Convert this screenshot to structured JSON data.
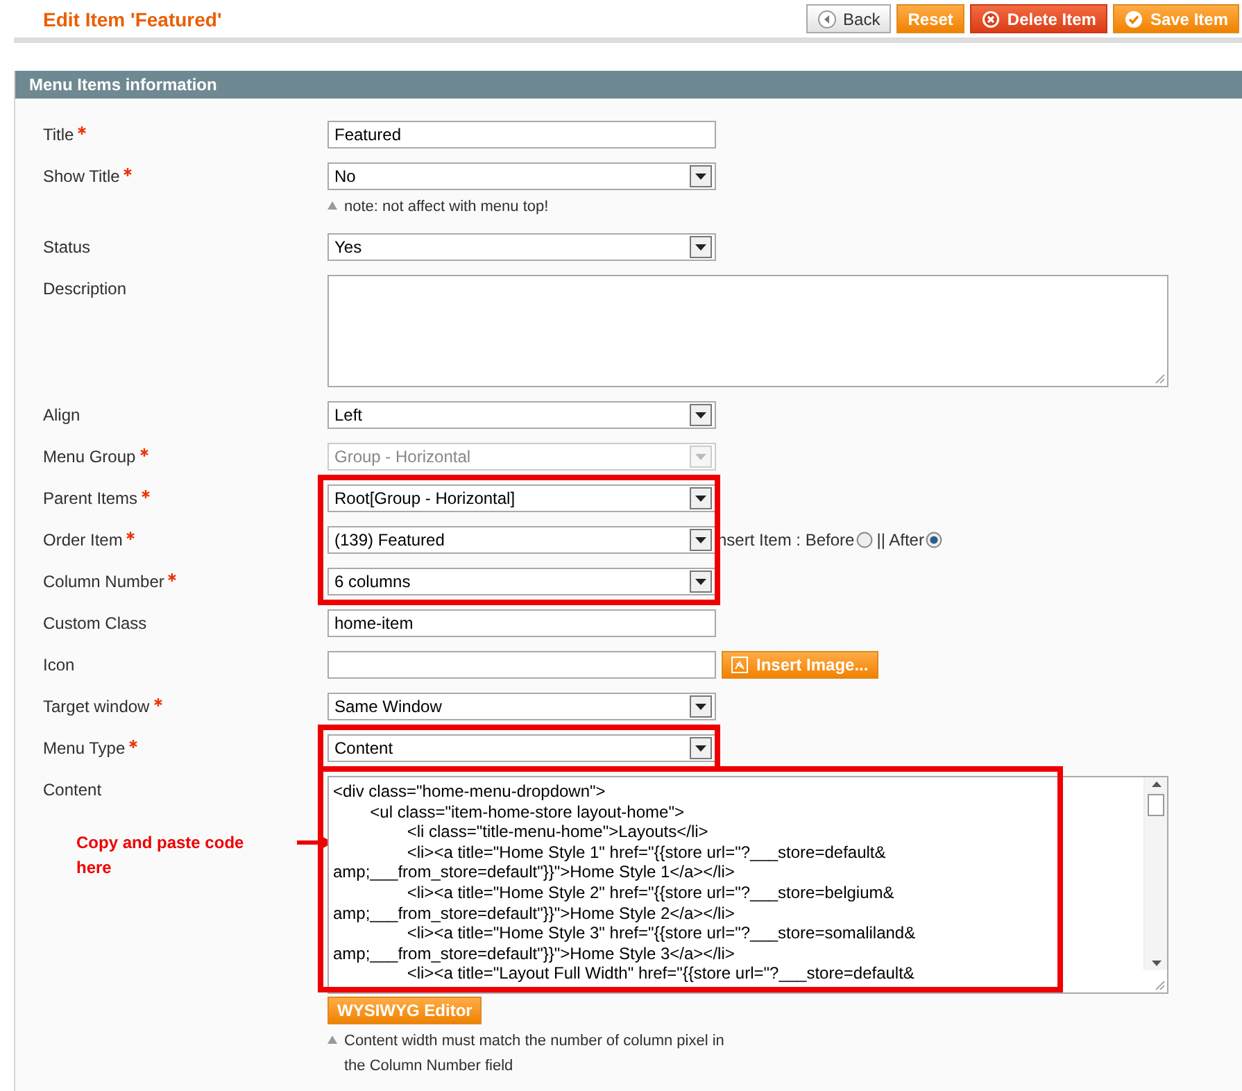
{
  "header": {
    "title": "Edit Item 'Featured'",
    "buttons": [
      {
        "kind": "back",
        "label": "Back"
      },
      {
        "kind": "plain",
        "label": "Reset"
      },
      {
        "kind": "delete",
        "label": "Delete Item"
      },
      {
        "kind": "save",
        "label": "Save Item"
      }
    ]
  },
  "panel": {
    "title": "Menu Items information",
    "fields": [
      {
        "kind": "text",
        "label": "Title",
        "required": true,
        "value": "Featured",
        "highlighted": false
      },
      {
        "kind": "select",
        "label": "Show Title",
        "required": true,
        "value": "No",
        "highlighted": false,
        "note": "note: not affect with menu top!"
      },
      {
        "kind": "select",
        "label": "Status",
        "required": false,
        "value": "Yes",
        "highlighted": false
      },
      {
        "kind": "textarea",
        "label": "Description",
        "required": false,
        "highlighted": false
      },
      {
        "kind": "select",
        "label": "Align",
        "required": false,
        "value": "Left",
        "highlighted": false
      },
      {
        "kind": "select",
        "label": "Menu Group",
        "required": true,
        "value": "Group - Horizontal",
        "disabled": true,
        "highlighted": false
      },
      {
        "kind": "select",
        "label": "Parent Items",
        "required": true,
        "value": "Root[Group - Horizontal]",
        "highlighted": true
      },
      {
        "kind": "select",
        "label": "Order Item",
        "required": true,
        "value": "(139) Featured",
        "highlighted": true,
        "positions": [
          {
            "label": "nsert Item : Before",
            "selected": false
          },
          {
            "label": "|| After",
            "selected": true
          }
        ]
      },
      {
        "kind": "select",
        "label": "Column Number",
        "required": true,
        "value": "6 columns",
        "highlighted": true
      },
      {
        "kind": "text",
        "label": "Custom Class",
        "required": false,
        "value": "home-item",
        "highlighted": false
      },
      {
        "kind": "image",
        "label": "Icon",
        "required": false,
        "button": "Insert Image...",
        "highlighted": false
      },
      {
        "kind": "select",
        "label": "Target window",
        "required": true,
        "value": "Same Window",
        "highlighted": false
      },
      {
        "kind": "select",
        "label": "Menu Type",
        "required": true,
        "value": "Content",
        "highlighted": true
      },
      {
        "kind": "code",
        "label": "Content",
        "required": false,
        "highlighted": true,
        "annotation": "Copy and paste code here",
        "button": "WYSIWYG Editor",
        "note": "Content width must match the number of column pixel in the Column Number field",
        "lines": [
          "<div class=\"home-menu-dropdown\">",
          "\t<ul class=\"item-home-store layout-home\">",
          "\t\t<li class=\"title-menu-home\">Layouts</li>",
          "\t\t<li><a title=\"Home Style 1\" href=\"{{store url=\"?___store=default&",
          "amp;___from_store=default\"}}\">Home Style 1</a></li>",
          "\t\t<li><a title=\"Home Style 2\" href=\"{{store url=\"?___store=belgium&",
          "amp;___from_store=default\"}}\">Home Style 2</a></li>",
          "\t\t<li><a title=\"Home Style 3\" href=\"{{store url=\"?___store=somaliland&",
          "amp;___from_store=default\"}}\">Home Style 3</a></li>",
          "\t\t<li><a title=\"Layout Full Width\" href=\"{{store url=\"?___store=default&"
        ]
      }
    ]
  }
}
